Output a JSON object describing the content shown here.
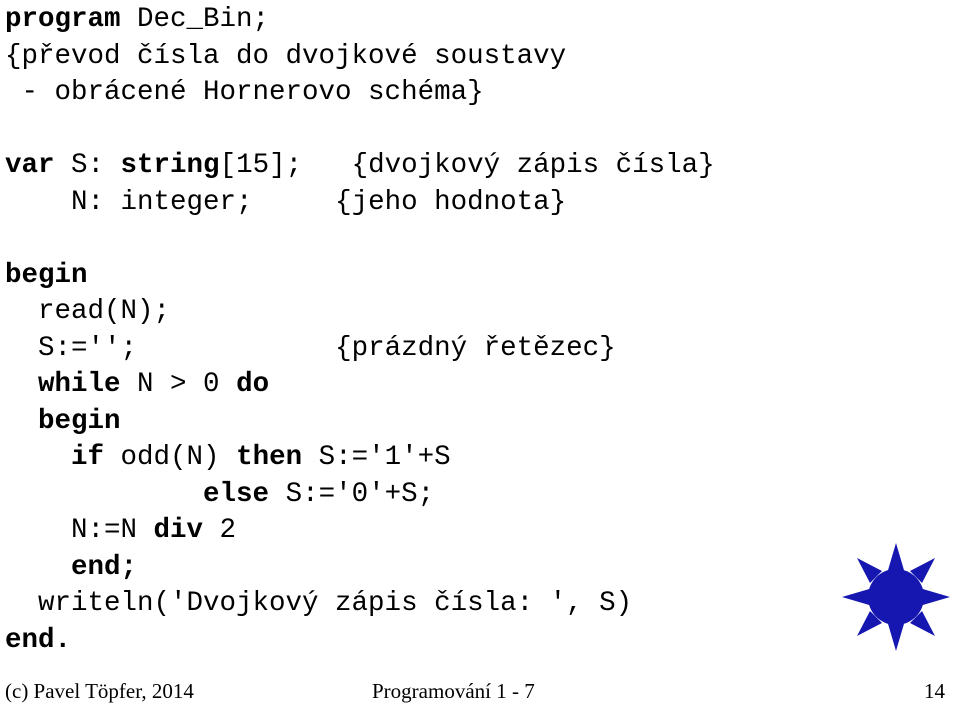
{
  "slide": {
    "language": "cs",
    "title_program": "Dec_Bin",
    "text_color": "#000000",
    "background_color": "#ffffff",
    "code_lines": [
      {
        "indent": 0,
        "segments": [
          {
            "style": "kw",
            "text": "program"
          },
          {
            "style": "pl",
            "text": " Dec_Bin;"
          }
        ]
      },
      {
        "indent": 0,
        "segments": [
          {
            "style": "pl",
            "text": "{převod čísla do dvojkové soustavy"
          }
        ]
      },
      {
        "indent": 0,
        "segments": [
          {
            "style": "pl",
            "text": " - obrácené Hornerovo schéma}"
          }
        ]
      },
      {
        "indent": 0,
        "segments": []
      },
      {
        "indent": 0,
        "segments": [
          {
            "style": "kw",
            "text": "var"
          },
          {
            "style": "pl",
            "text": " S: "
          },
          {
            "style": "kw",
            "text": "string"
          },
          {
            "style": "pl",
            "text": "[15];   "
          },
          {
            "style": "cmt",
            "text": "{dvojkový zápis čísla}"
          }
        ]
      },
      {
        "indent": 0,
        "segments": [
          {
            "style": "pl",
            "text": "    N: integer;     "
          },
          {
            "style": "cmt",
            "text": "{jeho hodnota}"
          }
        ]
      },
      {
        "indent": 0,
        "segments": []
      },
      {
        "indent": 0,
        "segments": [
          {
            "style": "kw",
            "text": "begin"
          }
        ]
      },
      {
        "indent": 0,
        "segments": [
          {
            "style": "pl",
            "text": "  read(N);"
          }
        ]
      },
      {
        "indent": 0,
        "segments": [
          {
            "style": "pl",
            "text": "  S:='';            "
          },
          {
            "style": "cmt",
            "text": "{prázdný řetězec}"
          }
        ]
      },
      {
        "indent": 0,
        "segments": [
          {
            "style": "pl",
            "text": "  "
          },
          {
            "style": "kw",
            "text": "while"
          },
          {
            "style": "pl",
            "text": " N > 0 "
          },
          {
            "style": "kw",
            "text": "do"
          }
        ]
      },
      {
        "indent": 0,
        "segments": [
          {
            "style": "pl",
            "text": "  "
          },
          {
            "style": "kw",
            "text": "begin"
          }
        ]
      },
      {
        "indent": 0,
        "segments": [
          {
            "style": "pl",
            "text": "    "
          },
          {
            "style": "kw",
            "text": "if"
          },
          {
            "style": "pl",
            "text": " odd(N) "
          },
          {
            "style": "kw",
            "text": "then"
          },
          {
            "style": "pl",
            "text": " S:='1'+S"
          }
        ]
      },
      {
        "indent": 0,
        "segments": [
          {
            "style": "pl",
            "text": "            "
          },
          {
            "style": "kw",
            "text": "else"
          },
          {
            "style": "pl",
            "text": " S:='0'+S;"
          }
        ]
      },
      {
        "indent": 0,
        "segments": [
          {
            "style": "pl",
            "text": "    N:=N "
          },
          {
            "style": "kw",
            "text": "div"
          },
          {
            "style": "pl",
            "text": " 2"
          }
        ]
      },
      {
        "indent": 0,
        "segments": [
          {
            "style": "pl",
            "text": "    "
          },
          {
            "style": "kw",
            "text": "end;"
          }
        ]
      },
      {
        "indent": 0,
        "segments": [
          {
            "style": "pl",
            "text": "  writeln('Dvojkový zápis čísla: ', S)"
          }
        ]
      },
      {
        "indent": 0,
        "segments": [
          {
            "style": "kw",
            "text": "end."
          }
        ]
      }
    ]
  },
  "logo": {
    "name": "sun-logo",
    "color": "#1616B0",
    "ray_count": 8,
    "description": "blue sun with eight triangular rays"
  },
  "footer": {
    "copyright": "(c) Pavel Töpfer, 2014",
    "course": "Programování 1 - 7",
    "page_number": "14"
  }
}
